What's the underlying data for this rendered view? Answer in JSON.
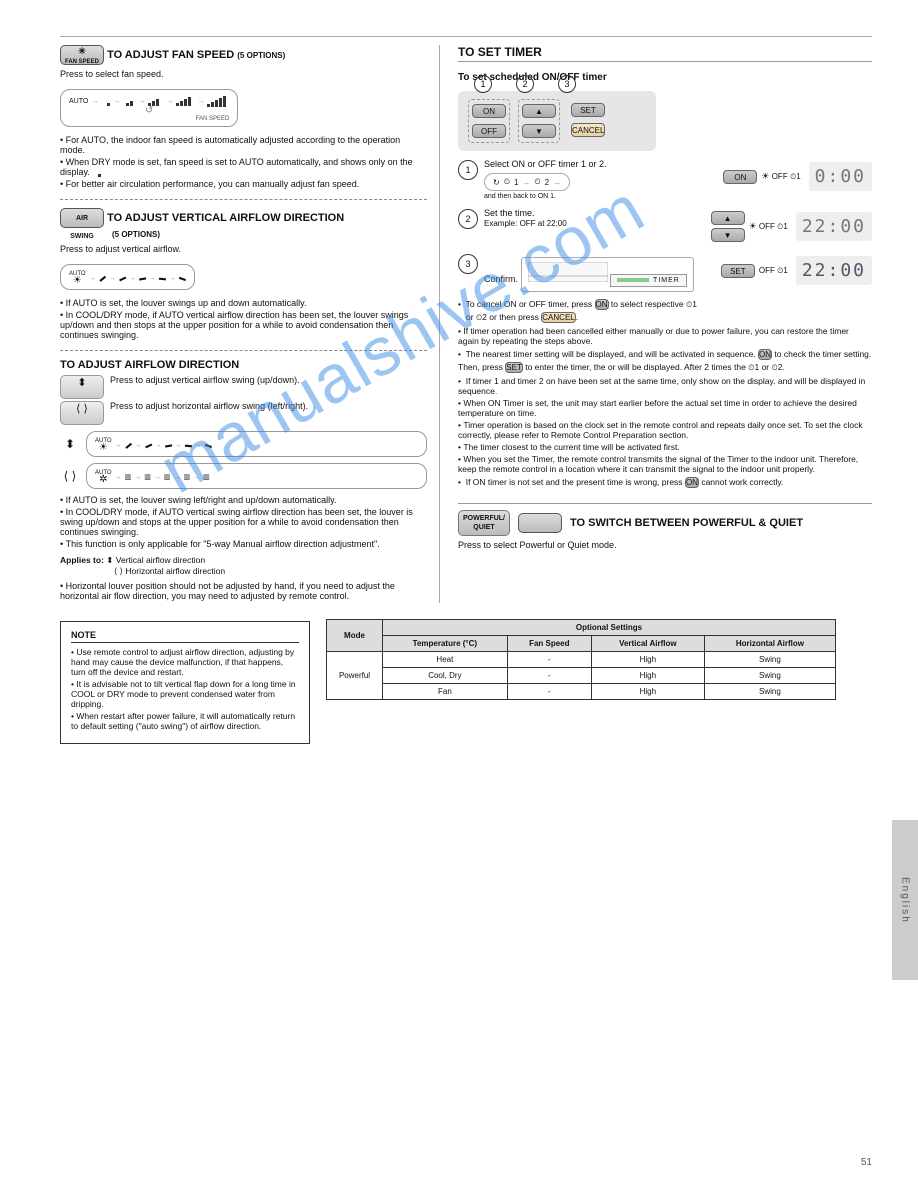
{
  "left": {
    "fan": {
      "title": "TO ADJUST FAN SPEED",
      "withLabel": "(5 OPTIONS)",
      "pressLead": "Press             to select fan speed.",
      "seqLabels": [
        "AUTO",
        "FAN SPEED"
      ],
      "bullets": [
        "For AUTO, the indoor fan speed is automatically adjusted according to the operation mode.",
        "When DRY mode is set, fan speed is set to AUTO automatically, and shows only          on the display.",
        "For better air circulation performance, you can manually adjust fan speed."
      ]
    },
    "airflow": {
      "title": "TO ADJUST VERTICAL AIRFLOW DIRECTION",
      "withLabel": "(5 OPTIONS)",
      "pressLead": "Press                  to adjust vertical airflow.",
      "noteBullets": [
        "If AUTO is set, the louver swings up and down automatically.",
        "In COOL/DRY mode, if AUTO vertical airflow direction has been set, the louver swings up/down and then stops at the upper position for a while to avoid condensation then continues swinging."
      ]
    },
    "swing": {
      "title": "TO ADJUST AIRFLOW DIRECTION",
      "pressVert": "Press             to adjust vertical airflow swing (up/down).",
      "pressHorz": "Press             to adjust horizontal airflow swing (left/right).",
      "bullets": [
        "If AUTO is set, the louver swing left/right and up/down automatically.",
        "In COOL/DRY mode, if AUTO vertical swing airflow direction has been set, the louver is swing up/down and stops at the upper position for a while to avoid condensation then continues swinging.",
        "This function is only applicable for \"5-way Manual airflow direction adjustment\"."
      ],
      "appliesLabel": "Applies to:",
      "appliesItems": [
        "Vertical airflow direction",
        "Horizontal airflow direction"
      ],
      "horizontalNote": "Horizontal louver position should not be adjusted by hand, if you need to adjust the horizontal air flow direction, you may need to adjusted by remote control."
    },
    "noteBox": {
      "header": "NOTE",
      "items": [
        "Use remote control to adjust airflow direction, adjusting by hand may cause the device malfunction, if that happens, turn off the device and restart.",
        "It is advisable not to tilt vertical flap down for a long time in COOL or DRY mode to prevent condensed water from dripping.",
        "When restart after power failure, it will automatically return to default setting (\"auto swing\") of airflow direction."
      ]
    }
  },
  "right": {
    "title": "TO SET TIMER",
    "subtitle": "To set scheduled ON/OFF timer",
    "circles": [
      "1",
      "2",
      "3"
    ],
    "btnLabels": {
      "on": "ON",
      "off": "OFF",
      "set": "SET",
      "cancel": "CANCEL",
      "up": "▲",
      "down": "▼"
    },
    "step1": {
      "text": "Select ON or OFF timer 1 or 2.",
      "seq": [
        "1",
        "2"
      ],
      "seqNote": "and then back to ON 1."
    },
    "step2": {
      "text": "Set the time.",
      "example": "Example: OFF at 22:00"
    },
    "step3": {
      "text": "Confirm."
    },
    "lcd": {
      "blank": "0:00",
      "time": "22:00",
      "offLabel": "OFF",
      "onIcon": "☀",
      "timerTag": "TIMER",
      "t1": "1",
      "t2": "2"
    },
    "afterBullets": [
      {
        "pre": "To cancel ON or OFF timer, press",
        "mid": "to select respective",
        "post": "or       then press"
      },
      {
        "text": "If timer operation had been cancelled either manually or due to power failure, you can restore the timer again by repeating the steps above."
      },
      {
        "pre": "When ON Timer is set, the unit may start earlier before the actual set time in order to achieve the desired temperature on time."
      },
      {
        "pre": "Timer operation is based on the clock set in the remote control and repeats daily once set. To set the clock correctly, please refer to Remote Control Preparation section."
      },
      {
        "text": "The timer closest to the current time will be activated first."
      },
      {
        "pre": "The nearest timer setting will be displayed, and will be activated in sequence.",
        "post": "to check the timer setting. Then, press",
        "post2": "to enter the timer, the      or       will be displayed. After 2 times the"
      },
      {
        "pre": "If timer 1 and timer 2 on have been set at the same time, only show       on the display.       and        will be displayed in sequence."
      },
      {
        "text": "When you set the Timer, the remote control transmits the signal of the Timer to the indoor unit. Therefore, keep the remote control in a location where it can transmit the signal to the indoor unit properly."
      },
      {
        "pre": "If ON timer is not set and the present time is wrong, press",
        "post": "cannot work correctly."
      }
    ],
    "pq": {
      "title": "TO SWITCH BETWEEN POWERFUL & QUIET",
      "btnLabel": "POWERFUL/\nQUIET",
      "pressLead": "Press             to select Powerful or Quiet mode."
    }
  },
  "table": {
    "header": "Optional Settings",
    "cols": [
      "Mode",
      "Temperature (°C)",
      "Fan Speed",
      "Vertical Airflow",
      "Horizontal Airflow"
    ],
    "rowHeads": [
      "Heat",
      "Cool, Dry",
      "Fan"
    ],
    "rows": [
      [
        "Heat",
        "-",
        "High",
        "Swing",
        "Swing"
      ],
      [
        "Powerful",
        "Cool, Dry",
        "-",
        "High",
        "Swing",
        "Swing"
      ],
      [
        "",
        "Fan",
        "-",
        "High",
        "Swing",
        "Swing"
      ]
    ],
    "modeSpan": "Powerful"
  },
  "sideTab": "English",
  "pageNum": "51",
  "watermark": "manualshive.com"
}
